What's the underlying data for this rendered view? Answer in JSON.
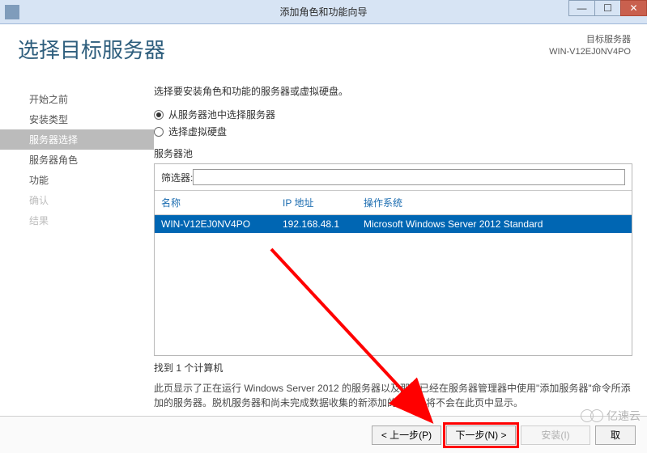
{
  "window": {
    "title": "添加角色和功能向导"
  },
  "header": {
    "page_title": "选择目标服务器",
    "target_label": "目标服务器",
    "target_name": "WIN-V12EJ0NV4PO"
  },
  "sidebar": {
    "items": [
      {
        "label": "开始之前",
        "state": "normal"
      },
      {
        "label": "安装类型",
        "state": "normal"
      },
      {
        "label": "服务器选择",
        "state": "selected"
      },
      {
        "label": "服务器角色",
        "state": "normal"
      },
      {
        "label": "功能",
        "state": "normal"
      },
      {
        "label": "确认",
        "state": "disabled"
      },
      {
        "label": "结果",
        "state": "disabled"
      }
    ]
  },
  "main": {
    "description": "选择要安装角色和功能的服务器或虚拟硬盘。",
    "radio_pool": "从服务器池中选择服务器",
    "radio_vhd": "选择虚拟硬盘",
    "pool_label": "服务器池",
    "filter_label": "筛选器:",
    "filter_value": "",
    "columns": {
      "name": "名称",
      "ip": "IP 地址",
      "os": "操作系统"
    },
    "rows": [
      {
        "name": "WIN-V12EJ0NV4PO",
        "ip": "192.168.48.1",
        "os": "Microsoft Windows Server 2012 Standard"
      }
    ],
    "found_text": "找到 1 个计算机",
    "footnote": "此页显示了正在运行 Windows Server 2012 的服务器以及那些已经在服务器管理器中使用\"添加服务器\"命令所添加的服务器。脱机服务器和尚未完成数据收集的新添加的服务器将不会在此页中显示。"
  },
  "footer": {
    "prev": "< 上一步(P)",
    "next": "下一步(N) >",
    "install": "安装(I)",
    "cancel": "取"
  },
  "watermark": "亿速云"
}
